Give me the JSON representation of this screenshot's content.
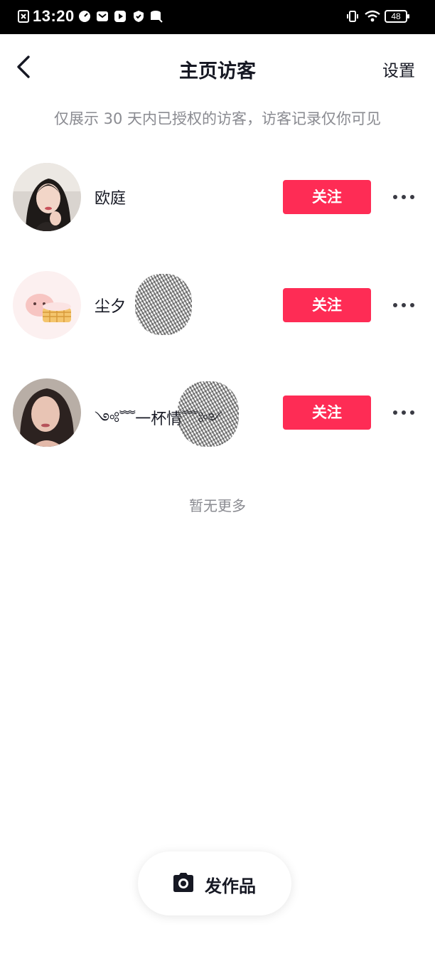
{
  "status_bar": {
    "time": "13:20",
    "battery": "48"
  },
  "header": {
    "title": "主页访客",
    "settings_label": "设置"
  },
  "notice": "仅展示 30 天内已授权的访客，访客记录仅你可见",
  "visitors": [
    {
      "name": "欧庭",
      "follow_label": "关注"
    },
    {
      "name": "尘夕",
      "follow_label": "关注"
    },
    {
      "name": "༺﹌一杯情﹌༻",
      "follow_label": "关注"
    }
  ],
  "footer_note": "暂无更多",
  "publish": {
    "label": "发作品"
  },
  "colors": {
    "accent": "#fe2c55",
    "text_primary": "#161823",
    "text_secondary": "#8a8b91"
  }
}
